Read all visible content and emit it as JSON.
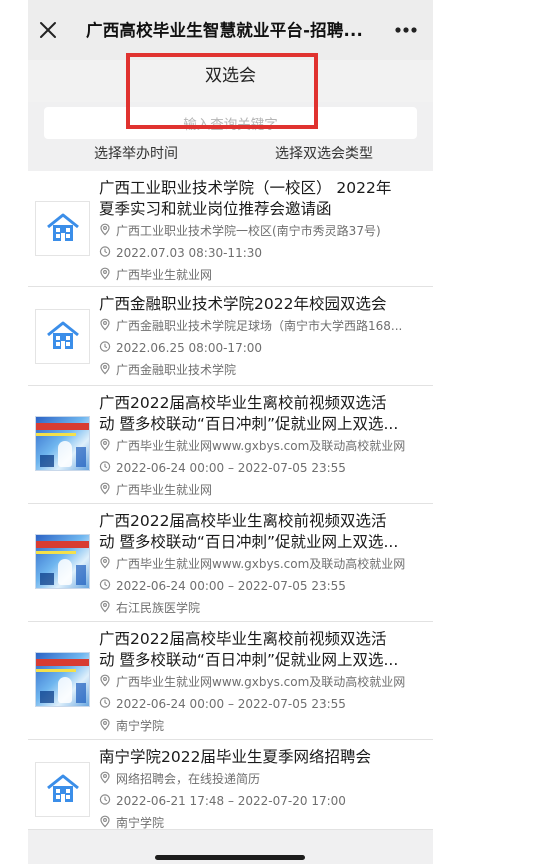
{
  "navbar": {
    "title": "广西高校毕业生智慧就业平台-招聘...",
    "close_icon": "close-icon",
    "more_icon": "more-dots-icon"
  },
  "header": {
    "title": "双选会"
  },
  "search": {
    "placeholder": "输入查询关键字"
  },
  "filters": {
    "time": "选择举办时间",
    "type": "选择双选会类型"
  },
  "colors": {
    "highlight_frame": "#e0322f",
    "house_icon": "#3b8ee9",
    "meta_text": "#6f6f6f"
  },
  "items": [
    {
      "thumb": "house-icon",
      "title_lines": [
        "广西工业职业技术学院（一校区） 2022年",
        "夏季实习和就业岗位推荐会邀请函"
      ],
      "location": "广西工业职业技术学院一校区(南宁市秀灵路37号)",
      "time": "2022.07.03 08:30-11:30",
      "organizer": "广西毕业生就业网"
    },
    {
      "thumb": "house-icon",
      "title_lines": [
        "广西金融职业技术学院2022年校园双选会"
      ],
      "location": "广西金融职业技术学院足球场（南宁市大学西路168...",
      "time": "2022.06.25 08:00-17:00",
      "organizer": "广西金融职业技术学院"
    },
    {
      "thumb": "poster-image",
      "title_lines": [
        "广西2022届高校毕业生离校前视频双选活",
        "动 暨多校联动“百日冲刺”促就业网上双选..."
      ],
      "location": "广西毕业生就业网www.gxbys.com及联动高校就业网",
      "time": "2022-06-24 00:00 – 2022-07-05 23:55",
      "organizer": "广西毕业生就业网"
    },
    {
      "thumb": "poster-image",
      "title_lines": [
        "广西2022届高校毕业生离校前视频双选活",
        "动 暨多校联动“百日冲刺”促就业网上双选..."
      ],
      "location": "广西毕业生就业网www.gxbys.com及联动高校就业网",
      "time": "2022-06-24 00:00 – 2022-07-05 23:55",
      "organizer": "右江民族医学院"
    },
    {
      "thumb": "poster-image",
      "title_lines": [
        "广西2022届高校毕业生离校前视频双选活",
        "动 暨多校联动“百日冲刺”促就业网上双选..."
      ],
      "location": "广西毕业生就业网www.gxbys.com及联动高校就业网",
      "time": "2022-06-24 00:00 – 2022-07-05 23:55",
      "organizer": "南宁学院"
    },
    {
      "thumb": "house-icon",
      "title_lines": [
        "南宁学院2022届毕业生夏季网络招聘会"
      ],
      "location": "网络招聘会，在线投递简历",
      "time": "2022-06-21 17:48 – 2022-07-20 17:00",
      "organizer": "南宁学院"
    }
  ]
}
